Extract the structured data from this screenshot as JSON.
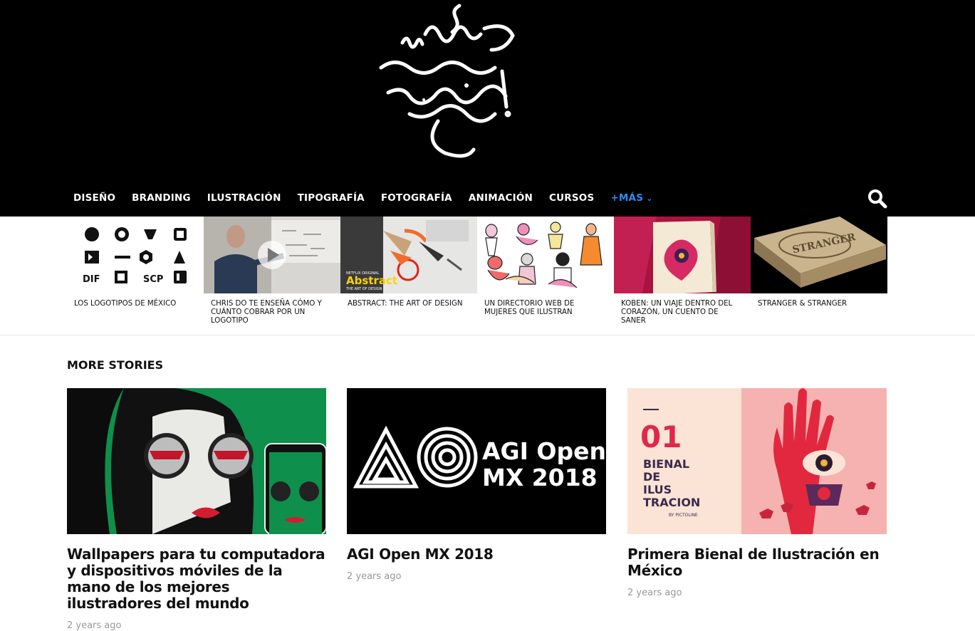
{
  "header": {
    "logo_text": "nice fucking graphics!"
  },
  "nav": {
    "items": [
      "DISEÑO",
      "BRANDING",
      "ILUSTRACIÓN",
      "TIPOGRAFÍA",
      "FOTOGRAFÍA",
      "ANIMACIÓN",
      "CURSOS"
    ],
    "more_label": "+MÁS",
    "search_icon": "search-icon"
  },
  "strip": {
    "items": [
      {
        "caption": "LOS LOGOTIPOS DE MÉXICO",
        "thumb": "logo-grid"
      },
      {
        "caption": "CHRIS DO TE ENSEÑA CÓMO Y CUÁNTO COBRAR POR UN LOGOTIPO",
        "thumb": "video"
      },
      {
        "caption": "ABSTRACT: THE ART OF DESIGN",
        "thumb": "abstract",
        "thumb_label_small": "NETFLIX ORIGINAL",
        "thumb_label": "Abstract",
        "thumb_sub": "THE ART OF DESIGN"
      },
      {
        "caption": "UN DIRECTORIO WEB DE MUJERES QUE ILUSTRAN",
        "thumb": "illustrations"
      },
      {
        "caption": "KOBEN: UN VIAJE DENTRO DEL CORAZÓN, UN CUENTO DE SANER",
        "thumb": "book"
      },
      {
        "caption": "STRANGER & STRANGER",
        "thumb": "box",
        "thumb_label": "STRANGER"
      }
    ],
    "logo_grid_labels": [
      "DIF",
      "SCP"
    ]
  },
  "more_stories": {
    "title": "MORE STORIES",
    "cards": [
      {
        "title": "Wallpapers para tu computadora y dispositivos móviles de la mano de los mejores ilustradores del mundo",
        "meta": "2 years ago"
      },
      {
        "title": "AGI Open MX 2018",
        "meta": "2 years ago",
        "image_text_1": "AGI Open",
        "image_text_2": "MX 2018"
      },
      {
        "title": "Primera Bienal de Ilustración en México",
        "meta": "2 years ago",
        "image_num": "01",
        "image_lines": [
          "BIENAL",
          "DE",
          "ILUS",
          "TRACION"
        ],
        "image_by": "BY PICTOLINE"
      }
    ]
  },
  "colors": {
    "header_bg": "#000000",
    "accent": "#2f8cf6",
    "meta": "#999999"
  }
}
